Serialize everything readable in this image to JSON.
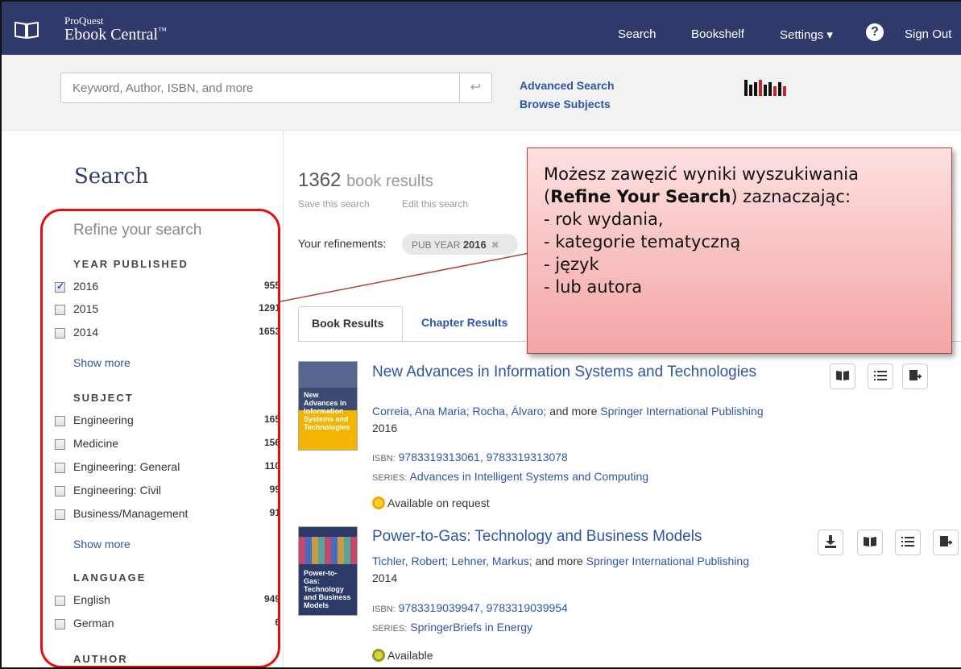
{
  "header": {
    "brand_small": "ProQuest",
    "brand_big": "Ebook Central",
    "brand_tm": "™",
    "nav": {
      "search": "Search",
      "bookshelf": "Bookshelf",
      "settings": "Settings ▾",
      "help": "?",
      "signout": "Sign Out"
    }
  },
  "search": {
    "placeholder": "Keyword, Author, ISBN, and more",
    "go": "↩",
    "advanced": "Advanced Search",
    "browse": "Browse Subjects"
  },
  "sidebar": {
    "title": "Search",
    "refine": "Refine your search",
    "year": {
      "heading": "YEAR PUBLISHED",
      "items": [
        {
          "label": "2016",
          "count": "955",
          "checked": true
        },
        {
          "label": "2015",
          "count": "1291",
          "checked": false
        },
        {
          "label": "2014",
          "count": "1653",
          "checked": false
        }
      ],
      "more": "Show more"
    },
    "subject": {
      "heading": "SUBJECT",
      "items": [
        {
          "label": "Engineering",
          "count": "165"
        },
        {
          "label": "Medicine",
          "count": "156"
        },
        {
          "label": "Engineering: General",
          "count": "110"
        },
        {
          "label": "Engineering: Civil",
          "count": "99"
        },
        {
          "label": "Business/Management",
          "count": "91"
        }
      ],
      "more": "Show more"
    },
    "language": {
      "heading": "LANGUAGE",
      "items": [
        {
          "label": "English",
          "count": "949"
        },
        {
          "label": "German",
          "count": "6"
        }
      ]
    },
    "author": {
      "heading": "AUTHOR"
    }
  },
  "main": {
    "count": "1362",
    "count_word": "book results",
    "save": "Save this search",
    "edit": "Edit this search",
    "refinements_label": "Your refinements:",
    "chip_key": "PUB YEAR",
    "chip_value": "2016",
    "chip_x": "✖",
    "tabs": [
      "Book Results",
      "Chapter Results"
    ],
    "results": [
      {
        "title": "New Advances in Information Systems and Technologies",
        "authors": "Correia, Ana Maria; Rocha, Álvaro;",
        "and_more": "and more",
        "publisher": "Springer International Publishing",
        "year": "2016",
        "isbn_label": "ISBN:",
        "isbn": "9783319313061, 9783319313078",
        "series_label": "SERIES:",
        "series": "Advances in Intelligent Systems and Computing",
        "availability": "Available on request",
        "cover_text": "New Advances in Information Systems and Technologies"
      },
      {
        "title": "Power-to-Gas: Technology and Business Models",
        "authors": "Tichler, Robert; Lehner, Markus;",
        "and_more": "and more",
        "publisher": "Springer International Publishing",
        "year": "2014",
        "isbn_label": "ISBN:",
        "isbn": "9783319039947, 9783319039954",
        "series_label": "SERIES:",
        "series": "SpringerBriefs in Energy",
        "availability": "Available",
        "cover_text": "Power-to-Gas: Technology and Business Models"
      }
    ]
  },
  "callout": {
    "line1": "Możesz zawęzić wyniki wyszukiwania",
    "line2_open": "(",
    "line2_bold": "Refine Your Search",
    "line2_rest": ") zaznaczając:",
    "items": [
      "- rok wydania,",
      "- kategorie tematyczną",
      "- język",
      "- lub autora"
    ]
  },
  "colors": {
    "header_bg": "#2f3a6b",
    "link": "#2f55a4",
    "outline_red": "#e01010",
    "callout_top": "#fde0e0",
    "callout_bottom": "#f4a5a5"
  }
}
